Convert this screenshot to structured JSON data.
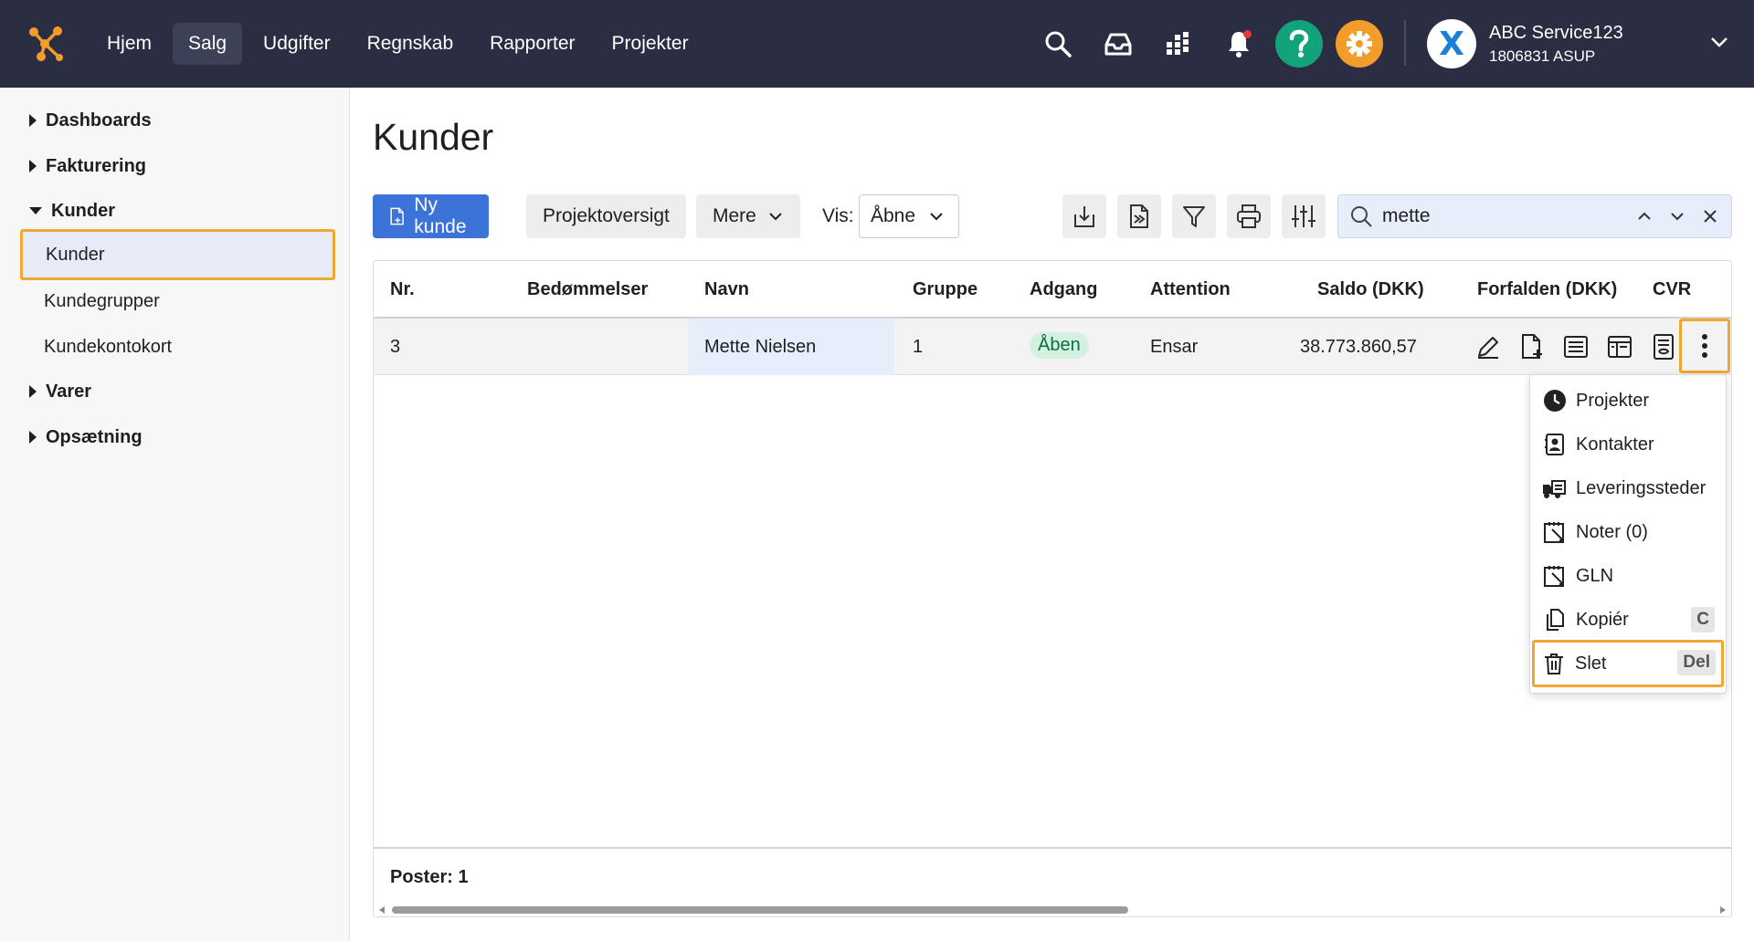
{
  "topbar": {
    "nav": [
      {
        "label": "Hjem"
      },
      {
        "label": "Salg",
        "active": true
      },
      {
        "label": "Udgifter"
      },
      {
        "label": "Regnskab"
      },
      {
        "label": "Rapporter"
      },
      {
        "label": "Projekter"
      }
    ],
    "icons": [
      "search-icon",
      "inbox-icon",
      "apps-grid-icon",
      "bell-icon",
      "help-icon",
      "gear-icon"
    ],
    "account": {
      "avatar_letter": "X",
      "name": "ABC Service123",
      "sub": "1806831 ASUP"
    },
    "colors": {
      "bar": "#2b2d42",
      "help": "#12a37a",
      "settings": "#f39c2a",
      "logo": "#f39c2a"
    }
  },
  "sidebar": {
    "items": [
      {
        "label": "Dashboards",
        "type": "section",
        "expanded": false
      },
      {
        "label": "Fakturering",
        "type": "section",
        "expanded": false
      },
      {
        "label": "Kunder",
        "type": "section",
        "expanded": true
      },
      {
        "label": "Kunder",
        "type": "sub",
        "selected": true
      },
      {
        "label": "Kundegrupper",
        "type": "sub"
      },
      {
        "label": "Kundekontokort",
        "type": "sub"
      },
      {
        "label": "Varer",
        "type": "section",
        "expanded": false
      },
      {
        "label": "Opsætning",
        "type": "section",
        "expanded": false
      }
    ]
  },
  "page": {
    "title": "Kunder"
  },
  "toolbar": {
    "new_customer": "Ny kunde",
    "project_overview": "Projektoversigt",
    "more": "Mere",
    "vis_label": "Vis:",
    "vis_value": "Åbne",
    "tools": [
      "download-icon",
      "export-document-icon",
      "filter-icon",
      "print-icon",
      "column-settings-icon"
    ]
  },
  "search": {
    "value": "mette"
  },
  "table": {
    "columns": [
      "Nr.",
      "Bedømmelser",
      "Navn",
      "Gruppe",
      "Adgang",
      "Attention",
      "Saldo (DKK)",
      "Forfalden (DKK)",
      "CVR"
    ],
    "rows": [
      {
        "nr": "3",
        "rating": "",
        "navn": "Mette Nielsen",
        "gruppe": "1",
        "adgang": "Åben",
        "attention": "Ensar",
        "saldo": "38.773.860,57",
        "forfalden": "",
        "cvr": ""
      }
    ],
    "row_actions": [
      "edit-icon",
      "new-document-icon",
      "list-icon",
      "layout-icon",
      "statement-icon",
      "more-vertical-icon"
    ],
    "footer": "Poster: 1",
    "scroll_position": 0.0
  },
  "row_menu": {
    "items": [
      {
        "label": "Projekter",
        "icon": "clock-icon",
        "shortcut": ""
      },
      {
        "label": "Kontakter",
        "icon": "contact-card-icon",
        "shortcut": ""
      },
      {
        "label": "Leveringssteder",
        "icon": "delivery-truck-icon",
        "shortcut": ""
      },
      {
        "label": "Noter (0)",
        "icon": "note-icon",
        "shortcut": ""
      },
      {
        "label": "GLN",
        "icon": "note-icon",
        "shortcut": ""
      },
      {
        "label": "Kopiér",
        "icon": "copy-icon",
        "shortcut": "C"
      },
      {
        "label": "Slet",
        "icon": "trash-icon",
        "shortcut": "Del",
        "highlighted": true
      }
    ]
  }
}
